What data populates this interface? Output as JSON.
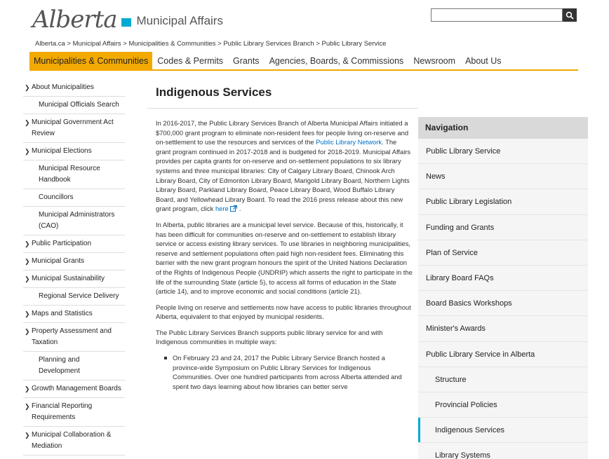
{
  "header": {
    "logo_wordmark": "Alberta",
    "department": "Municipal Affairs",
    "search_placeholder": ""
  },
  "breadcrumb": [
    "Alberta.ca",
    "Municipal Affairs",
    "Municipalities & Communities",
    "Public Library Services Branch",
    "Public Library Service"
  ],
  "breadcrumb_separator": " > ",
  "topnav": {
    "tabs": [
      "Municipalities & Communities",
      "Codes & Permits",
      "Grants",
      "Agencies, Boards, & Commissions",
      "Newsroom",
      "About Us"
    ]
  },
  "sidebar": {
    "items": [
      {
        "label": "About Municipalities",
        "arrow": true
      },
      {
        "label": "Municipal Officials Search",
        "arrow": false
      },
      {
        "label": "Municipal Government Act Review",
        "arrow": true
      },
      {
        "label": "Municipal Elections",
        "arrow": true
      },
      {
        "label": "Municipal Resource Handbook",
        "arrow": false
      },
      {
        "label": "Councillors",
        "arrow": false
      },
      {
        "label": "Municipal Administrators (CAO)",
        "arrow": false
      },
      {
        "label": "Public Participation",
        "arrow": true
      },
      {
        "label": "Municipal Grants",
        "arrow": true
      },
      {
        "label": "Municipal Sustainability",
        "arrow": true
      },
      {
        "label": "Regional Service Delivery",
        "arrow": false
      },
      {
        "label": "Maps and Statistics",
        "arrow": true
      },
      {
        "label": "Property Assessment and Taxation",
        "arrow": true
      },
      {
        "label": "Planning and Development",
        "arrow": false
      },
      {
        "label": "Growth Management Boards",
        "arrow": true
      },
      {
        "label": "Financial Reporting Requirements",
        "arrow": true
      },
      {
        "label": "Municipal Collaboration & Mediation",
        "arrow": true
      }
    ]
  },
  "main": {
    "title": "Indigenous Services",
    "p1_a": "In 2016-2017, the Public Library Services Branch of Alberta Municipal Affairs initiated a $700,000 grant program to eliminate non-resident fees for people living on-reserve and on-settlement to use the resources and services of the ",
    "p1_link": "Public Library Network",
    "p1_b": ".  The grant program continued in 2017-2018 and is budgeted for 2018-2019. Municipal Affairs provides per capita grants for on-reserve and on-settlement populations to six library systems and three municipal libraries: City of Calgary Library Board, Chinook Arch Library Board, City of Edmonton Library Board, Marigold Library Board, Northern Lights Library Board, Parkland Library Board, Peace Library Board, Wood Buffalo Library Board, and Yellowhead Library Board. To read the 2016 press release about this new grant program, click ",
    "p1_here": "here",
    "p1_end": " .",
    "p2": "In Alberta, public libraries are a municipal level service.  Because of this, historically, it has been difficult for communities on-reserve and on-settlement to establish library service or access existing library services. To use libraries in neighboring municipalities, reserve and settlement populations often paid high non-resident fees.  Eliminating this barrier with the new grant program honours the spirit of the United Nations Declaration of the Rights of Indigenous People (UNDRIP) which asserts the right to participate in the life of the surrounding State (article 5), to access all forms of education in the State (article 14), and to improve economic and social conditions (article 21).",
    "p3": "People living on reserve and settlements now have access to public libraries throughout Alberta, equivalent to that enjoyed by municipal residents.",
    "p4": "The Public Library Services Branch supports public library service for and with Indigenous communities in multiple ways:",
    "bullet1": "On February 23 and 24, 2017 the Public Library Service Branch hosted a province-wide Symposium on Public Library Services for Indigenous Communities.  Over one hundred participants from across Alberta attended and spent two days learning about how libraries can better serve"
  },
  "navpanel": {
    "heading": "Navigation",
    "items": [
      {
        "label": "Public Library Service",
        "sub": false,
        "current": false
      },
      {
        "label": "News",
        "sub": false,
        "current": false
      },
      {
        "label": "Public Library Legislation",
        "sub": false,
        "current": false
      },
      {
        "label": "Funding and Grants",
        "sub": false,
        "current": false
      },
      {
        "label": "Plan of Service",
        "sub": false,
        "current": false
      },
      {
        "label": "Library Board FAQs",
        "sub": false,
        "current": false
      },
      {
        "label": "Board Basics Workshops",
        "sub": false,
        "current": false
      },
      {
        "label": "Minister's Awards",
        "sub": false,
        "current": false
      },
      {
        "label": "Public Library Service in Alberta",
        "sub": false,
        "current": false
      },
      {
        "label": "Structure",
        "sub": true,
        "current": false
      },
      {
        "label": "Provincial Policies",
        "sub": true,
        "current": false
      },
      {
        "label": "Indigenous Services",
        "sub": true,
        "current": true
      },
      {
        "label": "Library Systems",
        "sub": true,
        "current": false
      }
    ]
  },
  "colors": {
    "accent": "#f2a900",
    "link": "#0070c4",
    "brand_blue": "#00aad2"
  }
}
